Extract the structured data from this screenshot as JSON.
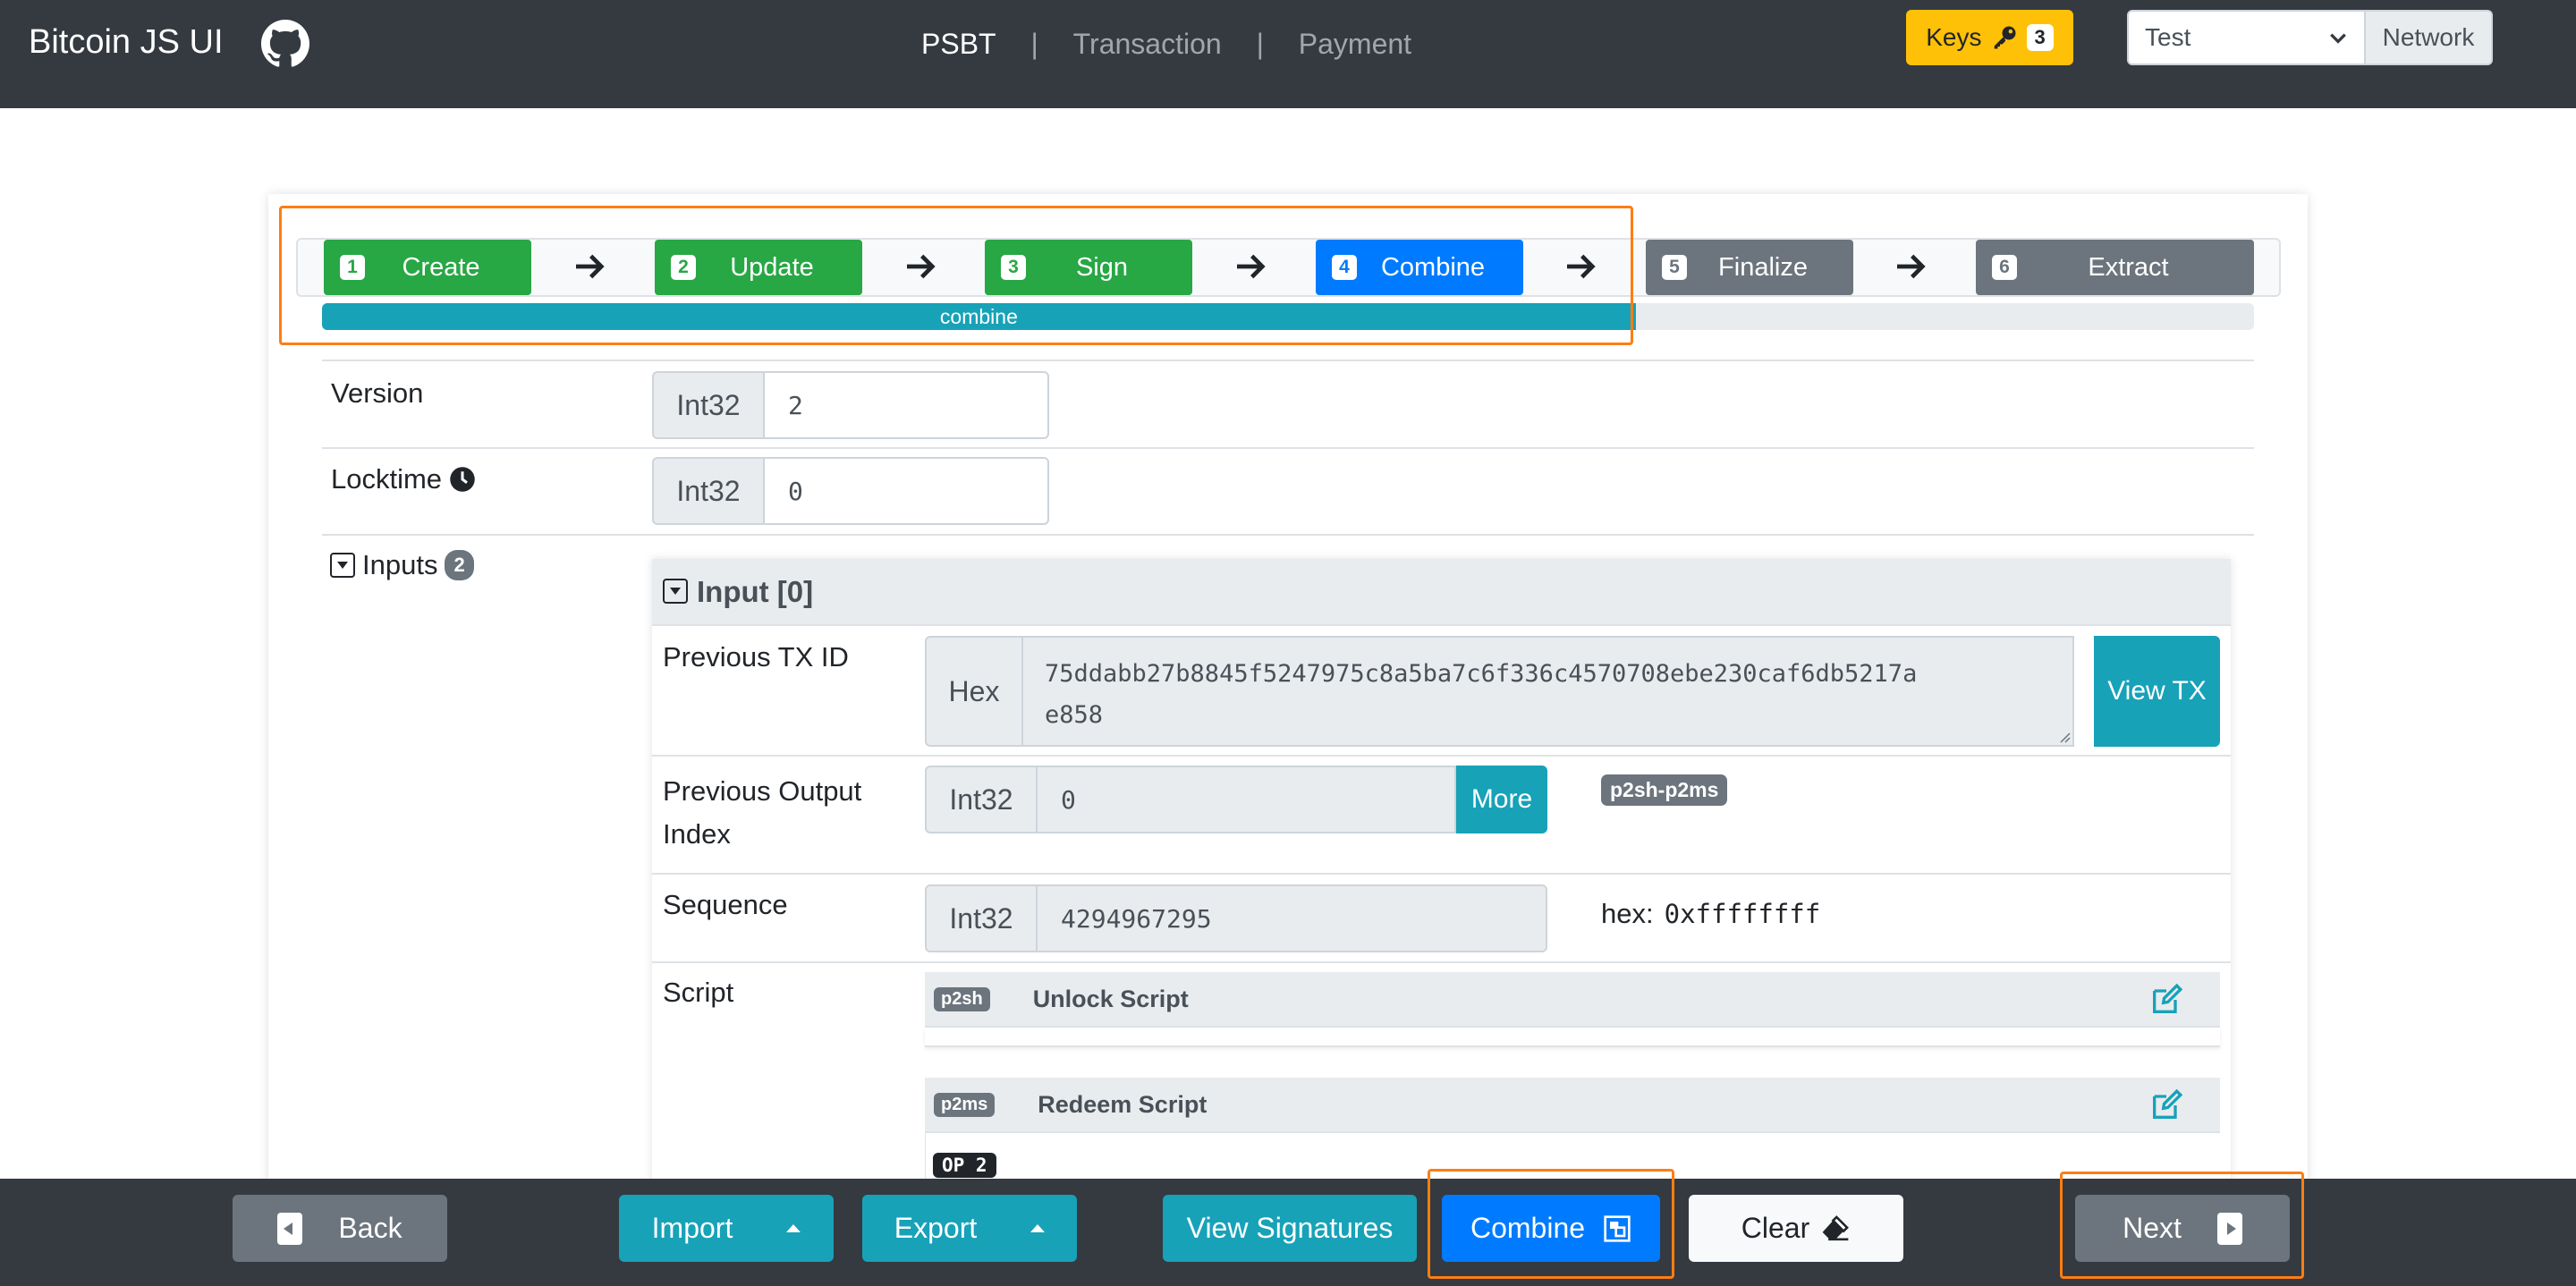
{
  "navbar": {
    "brand": "Bitcoin JS UI",
    "links": [
      "PSBT",
      "Transaction",
      "Payment"
    ],
    "separator": "|",
    "keys_label": "Keys",
    "keys_count": "3",
    "network_value": "Test",
    "network_label": "Network"
  },
  "stepper": {
    "steps": [
      {
        "num": "1",
        "label": "Create"
      },
      {
        "num": "2",
        "label": "Update"
      },
      {
        "num": "3",
        "label": "Sign"
      },
      {
        "num": "4",
        "label": "Combine"
      },
      {
        "num": "5",
        "label": "Finalize"
      },
      {
        "num": "6",
        "label": "Extract"
      }
    ],
    "progress_label": "combine",
    "progress_fraction": 0.68
  },
  "psbt": {
    "version": {
      "label": "Version",
      "type": "Int32",
      "value": "2"
    },
    "locktime": {
      "label": "Locktime",
      "type": "Int32",
      "value": "0"
    },
    "inputs": {
      "label": "Inputs",
      "count": "2"
    }
  },
  "input0": {
    "title": "Input [0]",
    "prev_txid": {
      "label": "Previous TX ID",
      "type": "Hex",
      "value_line1": "75ddabb27b8845f5247975c8a5ba7c6f336c4570708ebe230caf6db5217a",
      "value_line2": "e858",
      "button": "View TX"
    },
    "prev_index": {
      "label_line1": "Previous Output",
      "label_line2": "Index",
      "type": "Int32",
      "value": "0",
      "button": "More",
      "badge": "p2sh-p2ms"
    },
    "sequence": {
      "label": "Sequence",
      "type": "Int32",
      "value": "4294967295",
      "hex_label": "hex:",
      "hex_value": "0xffffffff"
    },
    "script": {
      "label": "Script",
      "unlock": {
        "badge": "p2sh",
        "title": "Unlock Script"
      },
      "redeem": {
        "badge": "p2ms",
        "title": "Redeem Script"
      },
      "op_badge": "OP 2"
    }
  },
  "bottom": {
    "back": "Back",
    "import": "Import",
    "export": "Export",
    "view_signatures": "View Signatures",
    "combine": "Combine",
    "clear": "Clear",
    "next": "Next"
  },
  "colors": {
    "navbar": "#343a40",
    "success": "#28a745",
    "primary": "#007bff",
    "secondary": "#6c757d",
    "info": "#17a2b8",
    "warning": "#ffc107",
    "highlight": "#fd7e14"
  }
}
